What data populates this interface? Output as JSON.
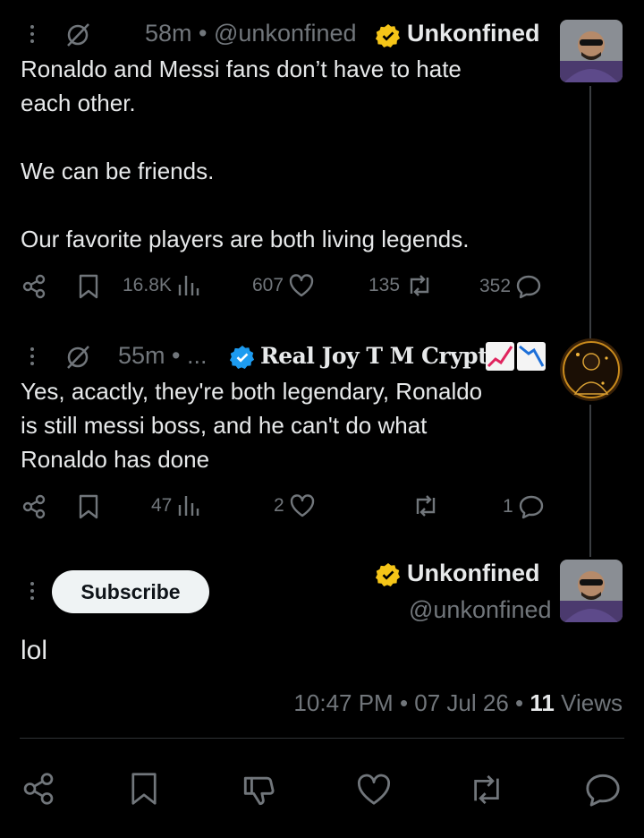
{
  "tweet1": {
    "time": "58m",
    "handle": "@unkonfined",
    "name": "Unkonfined",
    "text": "Ronaldo and Messi fans don’t have to hate\neach other.\n\nWe can be friends.\n\nOur favorite players are both living legends.",
    "views": "16.8K",
    "likes": "607",
    "reposts": "135",
    "replies": "352"
  },
  "tweet2": {
    "time": "55m",
    "separator_tail": "• ...",
    "name": "Real Joy T M Crypto",
    "text": "Yes, acactly, they're both legendary, Ronaldo\nis still messi boss, and he can't do what\nRonaldo has done",
    "views": "47",
    "likes": "2",
    "reposts": "",
    "replies": "1"
  },
  "main_tweet": {
    "subscribe_label": "Subscribe",
    "name": "Unkonfined",
    "handle": "@unkonfined",
    "text": "lol",
    "time": "10:47 PM",
    "date": "07 Jul 26",
    "views_count": "11",
    "views_label": "Views"
  },
  "colors": {
    "verified_gold": "#f5c518",
    "verified_blue": "#1d9bf0",
    "muted": "#71767b",
    "text": "#e7e9ea"
  },
  "icons": [
    "more-vertical-icon",
    "mute-circle-icon",
    "share-icon",
    "bookmark-icon",
    "views-chart-icon",
    "heart-icon",
    "repost-icon",
    "reply-icon",
    "dislike-icon",
    "verified-gold-icon",
    "verified-blue-icon",
    "chart-up-emoji",
    "chart-down-emoji"
  ]
}
